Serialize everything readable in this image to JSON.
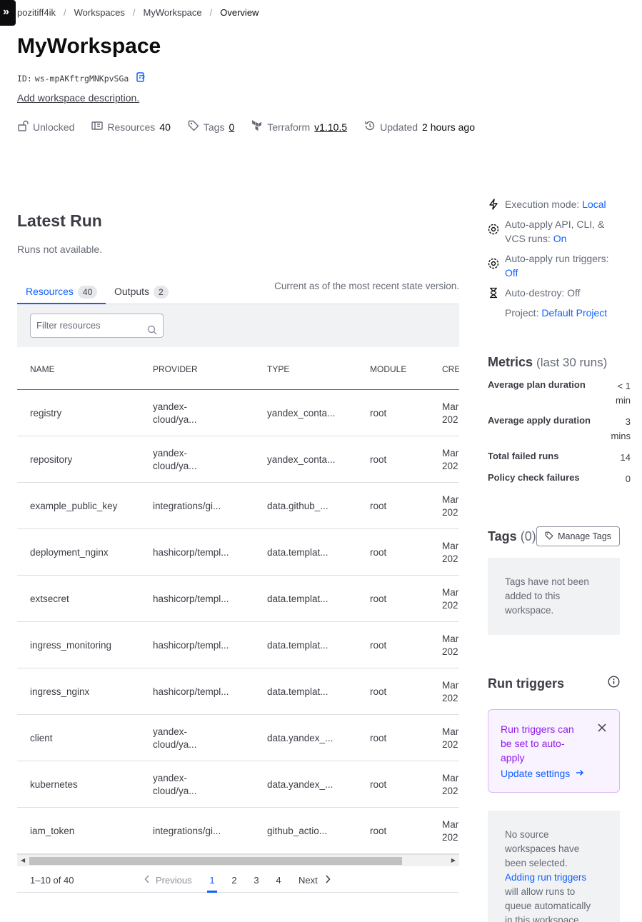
{
  "nav": {
    "expand_glyph": "»"
  },
  "breadcrumb": {
    "org": "pozitiff4ik",
    "workspaces": "Workspaces",
    "workspace": "MyWorkspace",
    "current": "Overview",
    "separator": "/"
  },
  "header": {
    "title": "MyWorkspace",
    "id_label": "ID:",
    "id_value": "ws-mpAKftrgMNKpvSGa",
    "add_description": "Add workspace description."
  },
  "meta": {
    "lock": "Unlocked",
    "resources_label": "Resources",
    "resources_count": "40",
    "tags_label": "Tags",
    "tags_count": "0",
    "terraform_label": "Terraform",
    "terraform_version": "v1.10.5",
    "updated_label": "Updated",
    "updated_value": "2 hours ago"
  },
  "latest_run": {
    "title": "Latest Run",
    "status": "Runs not available."
  },
  "tabs": {
    "resources_label": "Resources",
    "resources_count": "40",
    "outputs_label": "Outputs",
    "outputs_count": "2",
    "state_note": "Current as of the most recent state version."
  },
  "filter": {
    "placeholder": "Filter resources"
  },
  "table": {
    "headers": [
      "NAME",
      "PROVIDER",
      "TYPE",
      "MODULE",
      "CREA"
    ],
    "rows": [
      {
        "name": "registry",
        "provider": "yandex-cloud/ya...",
        "provider_l1": "yandex-",
        "provider_l2": "cloud/ya...",
        "type": "yandex_conta...",
        "module": "root",
        "created_l1": "Mar",
        "created_l2": "202"
      },
      {
        "name": "repository",
        "provider_l1": "yandex-",
        "provider_l2": "cloud/ya...",
        "type": "yandex_conta...",
        "module": "root",
        "created_l1": "Mar",
        "created_l2": "202"
      },
      {
        "name": "example_public_key",
        "provider_l1": "integrations/gi...",
        "provider_l2": "",
        "type": "data.github_...",
        "module": "root",
        "created_l1": "Mar",
        "created_l2": "202"
      },
      {
        "name": "deployment_nginx",
        "provider_l1": "hashicorp/templ...",
        "provider_l2": "",
        "type": "data.templat...",
        "module": "root",
        "created_l1": "Mar",
        "created_l2": "202"
      },
      {
        "name": "extsecret",
        "provider_l1": "hashicorp/templ...",
        "provider_l2": "",
        "type": "data.templat...",
        "module": "root",
        "created_l1": "Mar",
        "created_l2": "202"
      },
      {
        "name": "ingress_monitoring",
        "provider_l1": "hashicorp/templ...",
        "provider_l2": "",
        "type": "data.templat...",
        "module": "root",
        "created_l1": "Mar",
        "created_l2": "202"
      },
      {
        "name": "ingress_nginx",
        "provider_l1": "hashicorp/templ...",
        "provider_l2": "",
        "type": "data.templat...",
        "module": "root",
        "created_l1": "Mar",
        "created_l2": "202"
      },
      {
        "name": "client",
        "provider_l1": "yandex-",
        "provider_l2": "cloud/ya...",
        "type": "data.yandex_...",
        "module": "root",
        "created_l1": "Mar",
        "created_l2": "202"
      },
      {
        "name": "kubernetes",
        "provider_l1": "yandex-",
        "provider_l2": "cloud/ya...",
        "type": "data.yandex_...",
        "module": "root",
        "created_l1": "Mar",
        "created_l2": "202"
      },
      {
        "name": "iam_token",
        "provider_l1": "integrations/gi...",
        "provider_l2": "",
        "type": "github_actio...",
        "module": "root",
        "created_l1": "Mar",
        "created_l2": "202"
      }
    ]
  },
  "pagination": {
    "range": "1–10 of 40",
    "previous": "Previous",
    "pages": [
      "1",
      "2",
      "3",
      "4"
    ],
    "next": "Next"
  },
  "sidebar": {
    "execution_mode_label": "Execution mode:",
    "execution_mode_value": "Local",
    "auto_apply_label_l1": "Auto-apply API, CLI, &",
    "auto_apply_label_l2": "VCS runs:",
    "auto_apply_value": "On",
    "auto_apply_triggers_label": "Auto-apply run triggers:",
    "auto_apply_triggers_value": "Off",
    "auto_destroy_label": "Auto-destroy:",
    "auto_destroy_value": "Off",
    "project_label": "Project:",
    "project_value": "Default Project"
  },
  "metrics": {
    "title": "Metrics",
    "subtitle": "(last 30 runs)",
    "avg_plan_label": "Average plan duration",
    "avg_plan_l1": "< 1",
    "avg_plan_l2": "min",
    "avg_apply_label": "Average apply duration",
    "avg_apply_l1": "3",
    "avg_apply_l2": "mins",
    "failed_label": "Total failed runs",
    "failed_value": "14",
    "policy_label": "Policy check failures",
    "policy_value": "0"
  },
  "tags": {
    "title": "Tags",
    "count": "(0)",
    "manage_label": "Manage Tags",
    "empty_l1": "Tags have not been",
    "empty_l2": "added to this",
    "empty_l3": "workspace."
  },
  "run_triggers": {
    "title": "Run triggers",
    "alert_l1": "Run triggers can",
    "alert_l2": "be set to auto-",
    "alert_l3": "apply",
    "update_settings": "Update settings",
    "empty_l1": "No source",
    "empty_l2": "workspaces have",
    "empty_l3": "been selected.",
    "empty_link": "Adding run triggers",
    "empty_l4": "will allow runs to",
    "empty_l5": "queue automatically",
    "empty_l6": "in this workspace."
  },
  "colors": {
    "accent": "#1060ff",
    "alert_purple": "#911ced",
    "alert_bg": "#f9f2ff"
  }
}
